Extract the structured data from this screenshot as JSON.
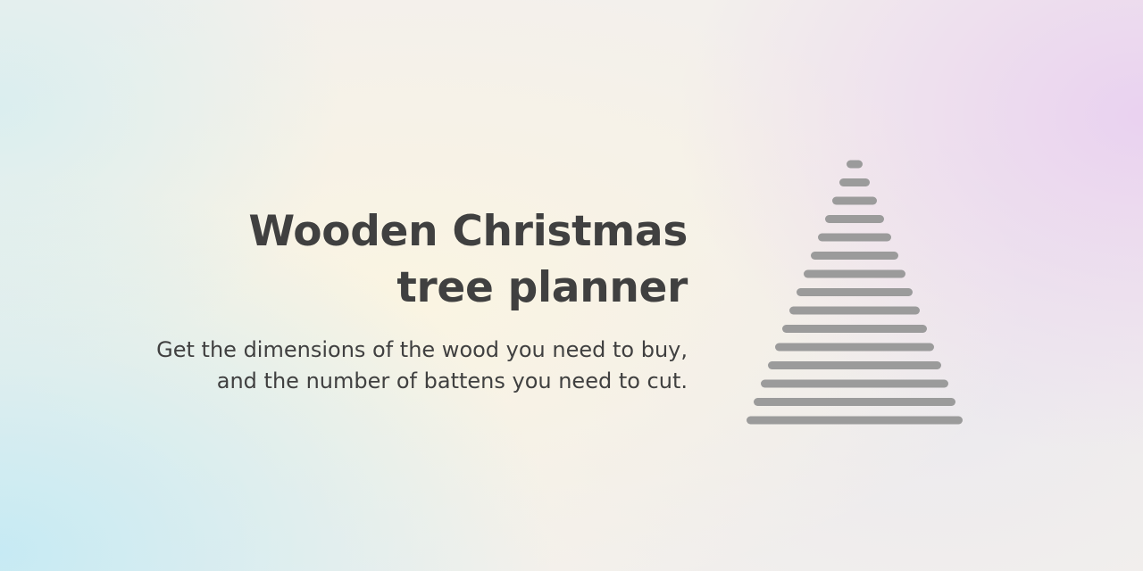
{
  "hero": {
    "title_line1": "Wooden Christmas",
    "title_line2": "tree planner",
    "subtitle_line1": "Get the dimensions of the wood you need to buy,",
    "subtitle_line2": "and the number of battens you need to cut."
  },
  "tree_illustration": {
    "icon": "christmas-tree-battens-icon",
    "batten_count": 15,
    "batten_color": "#9b9b9b"
  },
  "colors": {
    "text": "#404040",
    "background_center": "#faf4e2",
    "background_corner_top_right": "#e9d0f0",
    "background_corner_bottom_left": "#c4eaf4"
  }
}
